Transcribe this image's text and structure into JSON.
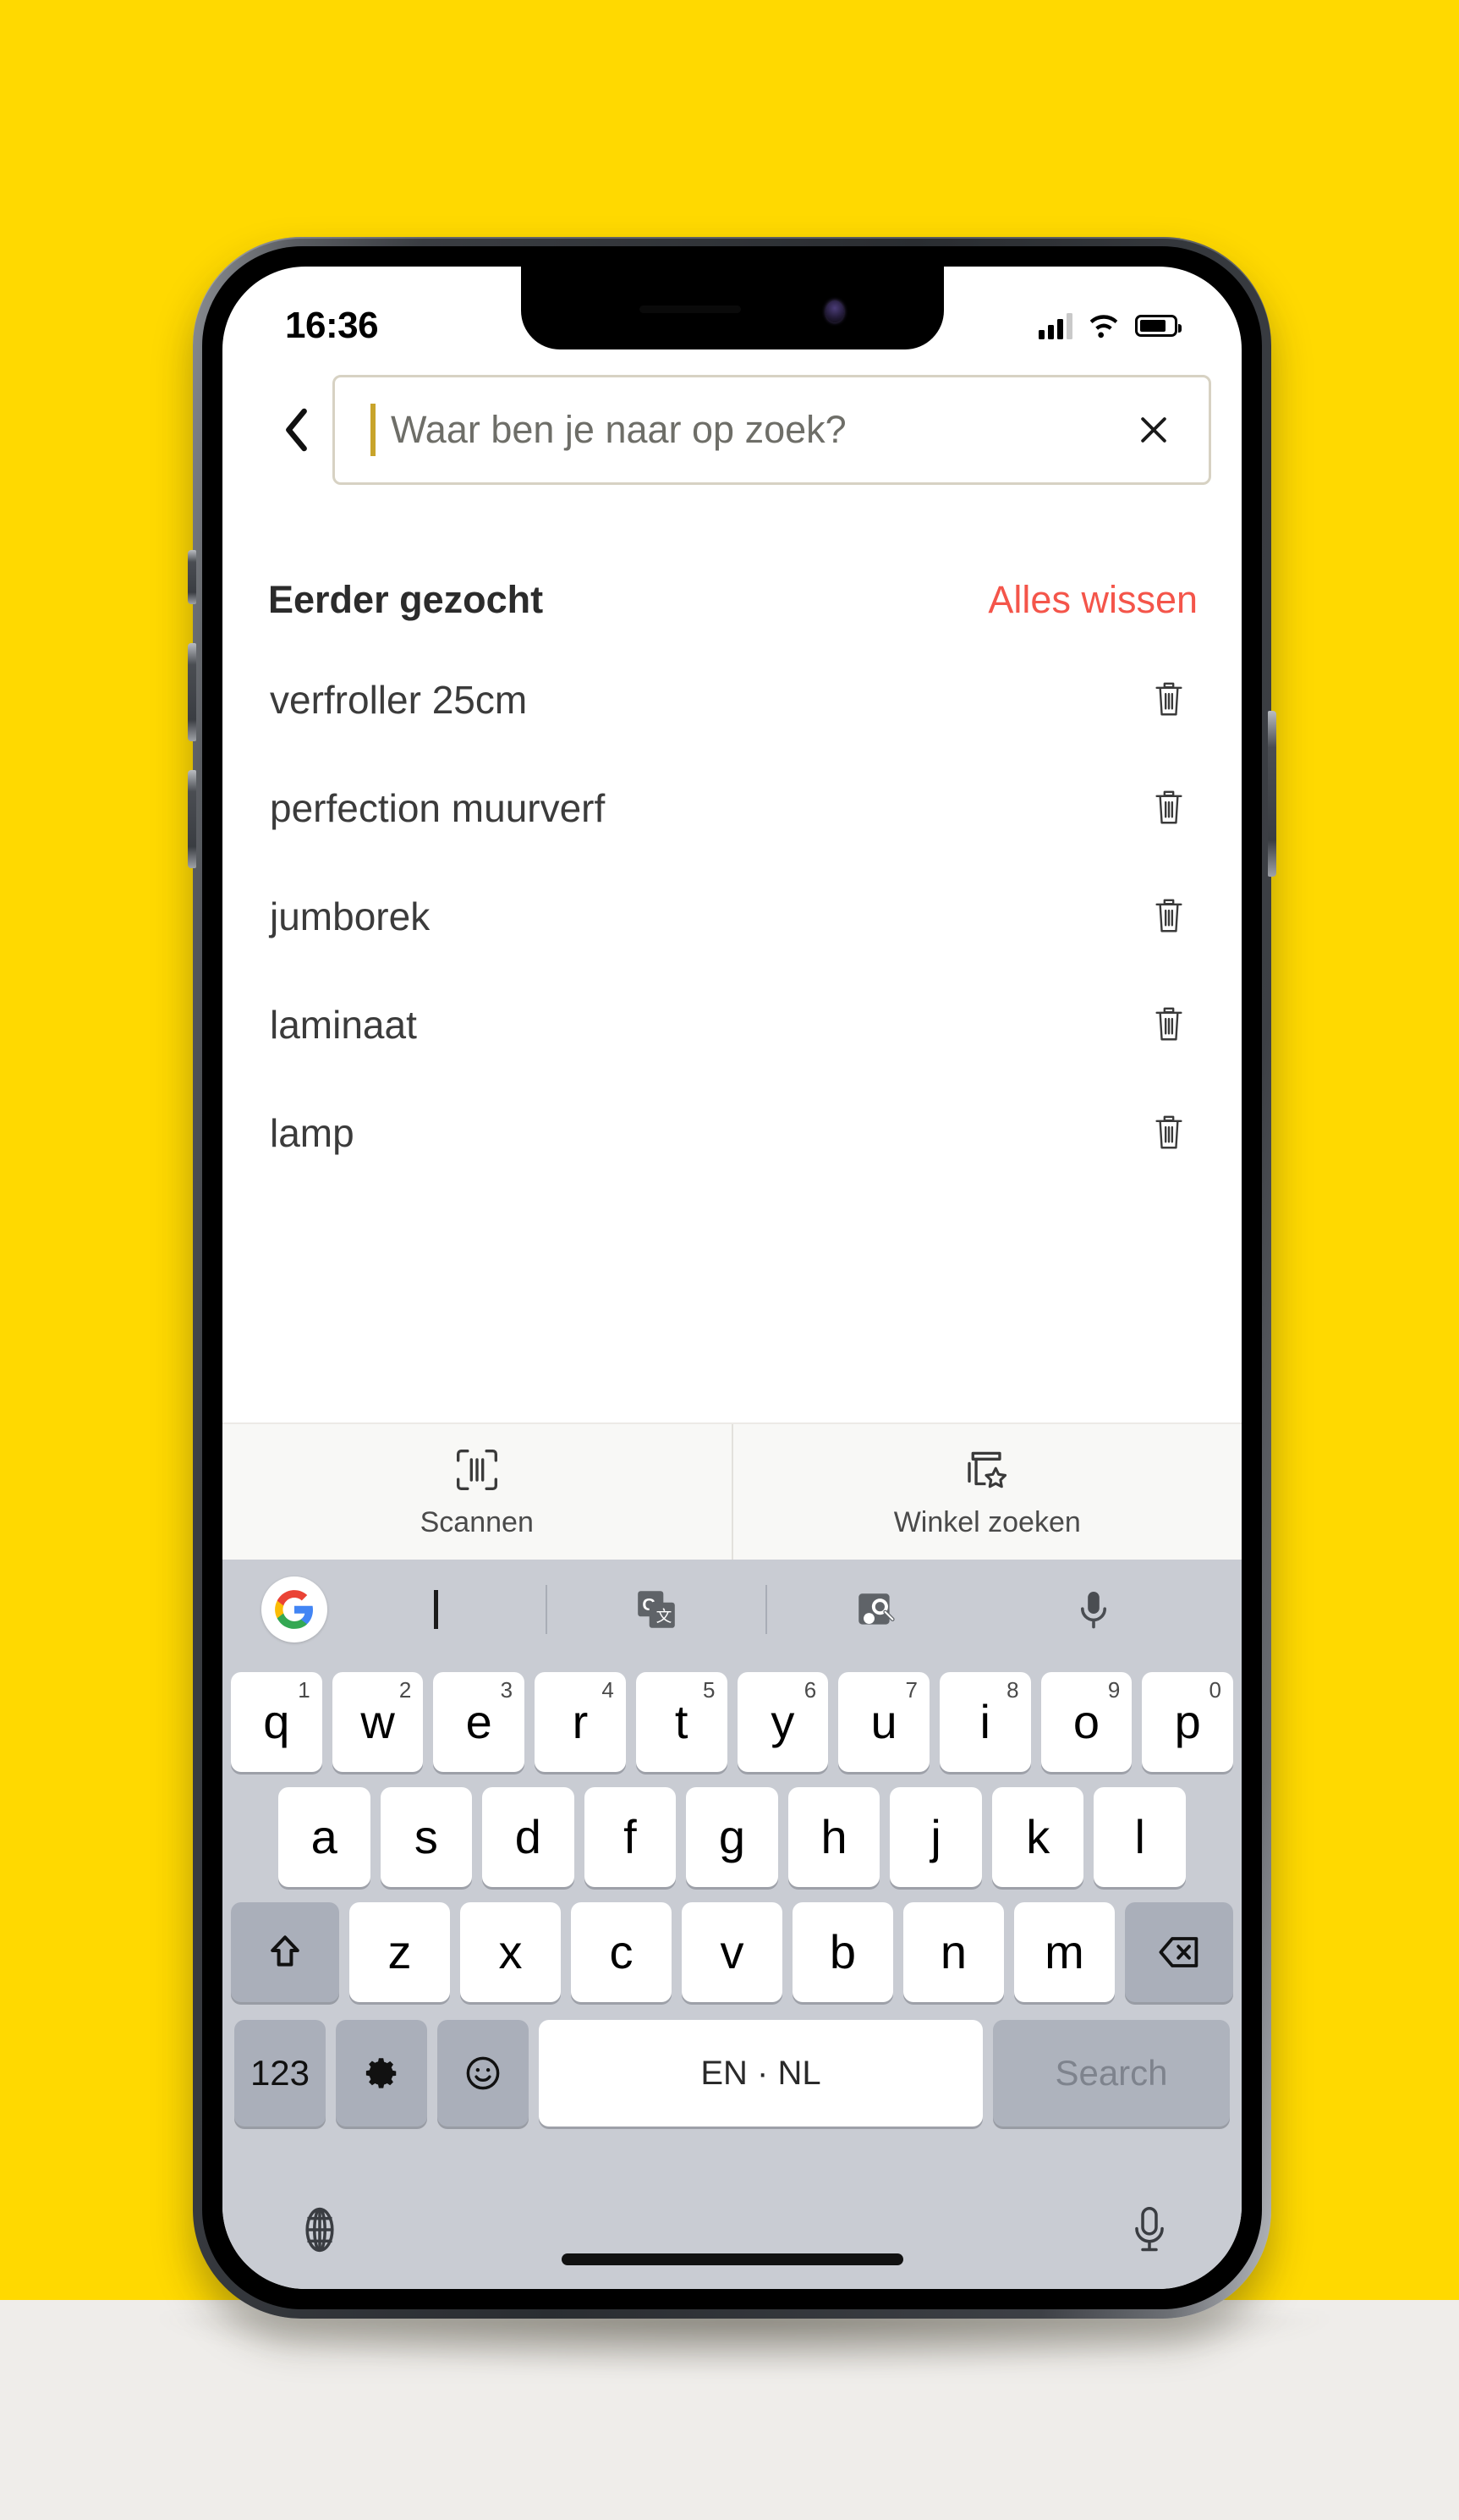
{
  "theme": {
    "background_yellow": "#ffd900",
    "floor": "#efedea",
    "accent_caret": "#c8a42b",
    "clear_all_red": "#f4554a",
    "keyboard_bg": "#c9ccd3"
  },
  "status_bar": {
    "time": "16:36",
    "signal_icon": "cellular-signal-icon",
    "wifi_icon": "wifi-icon",
    "battery_icon": "battery-icon"
  },
  "header": {
    "back_icon": "chevron-left-icon",
    "search": {
      "value": "",
      "placeholder": "Waar ben je naar op zoek?",
      "clear_icon": "close-icon"
    }
  },
  "recent": {
    "title": "Eerder gezocht",
    "clear_all_label": "Alles wissen",
    "delete_icon": "trash-icon",
    "items": [
      {
        "label": "verfroller 25cm"
      },
      {
        "label": "perfection muurverf"
      },
      {
        "label": "jumborek"
      },
      {
        "label": "laminaat"
      },
      {
        "label": "lamp"
      }
    ]
  },
  "quick_actions": [
    {
      "label": "Scannen",
      "icon": "barcode-scan-icon"
    },
    {
      "label": "Winkel zoeken",
      "icon": "store-star-icon"
    }
  ],
  "keyboard": {
    "toolbar": {
      "google_icon": "google-logo-icon",
      "cursor_icon": "text-cursor-icon",
      "translate_icon": "google-translate-icon",
      "lens_icon": "google-lens-icon",
      "mic_icon": "microphone-icon"
    },
    "row1": [
      {
        "letter": "q",
        "num": "1"
      },
      {
        "letter": "w",
        "num": "2"
      },
      {
        "letter": "e",
        "num": "3"
      },
      {
        "letter": "r",
        "num": "4"
      },
      {
        "letter": "t",
        "num": "5"
      },
      {
        "letter": "y",
        "num": "6"
      },
      {
        "letter": "u",
        "num": "7"
      },
      {
        "letter": "i",
        "num": "8"
      },
      {
        "letter": "o",
        "num": "9"
      },
      {
        "letter": "p",
        "num": "0"
      }
    ],
    "row2": [
      {
        "letter": "a"
      },
      {
        "letter": "s"
      },
      {
        "letter": "d"
      },
      {
        "letter": "f"
      },
      {
        "letter": "g"
      },
      {
        "letter": "h"
      },
      {
        "letter": "j"
      },
      {
        "letter": "k"
      },
      {
        "letter": "l"
      }
    ],
    "row3": [
      {
        "letter": "z"
      },
      {
        "letter": "x"
      },
      {
        "letter": "c"
      },
      {
        "letter": "v"
      },
      {
        "letter": "b"
      },
      {
        "letter": "n"
      },
      {
        "letter": "m"
      }
    ],
    "shift_icon": "shift-up-icon",
    "backspace_icon": "backspace-icon",
    "row4": {
      "numbers_label": "123",
      "settings_icon": "gear-icon",
      "emoji_icon": "emoji-smiley-icon",
      "space_label": "EN · NL",
      "enter_label": "Search"
    },
    "nav": {
      "globe_icon": "globe-icon",
      "mic_icon": "microphone-icon",
      "home_indicator": "home-indicator"
    }
  }
}
